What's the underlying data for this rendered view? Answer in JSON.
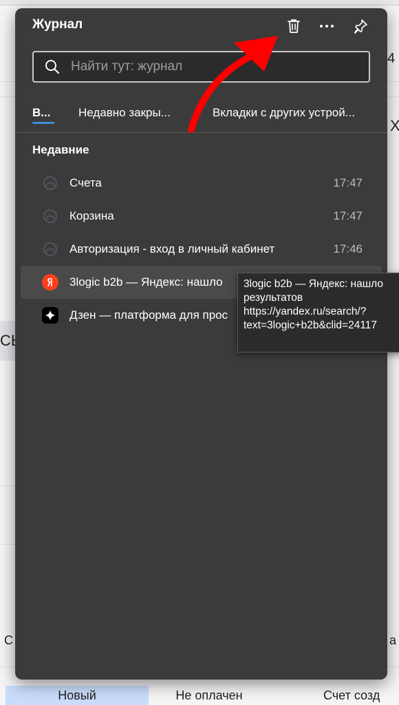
{
  "panel": {
    "title": "Журнал",
    "buttons": {
      "delete": "trash-icon",
      "more": "more-icon",
      "pin": "pin-icon"
    },
    "search_placeholder": "Найти тут: журнал"
  },
  "tabs": [
    {
      "label": "В...",
      "active": true
    },
    {
      "label": "Недавно закры...",
      "active": false
    },
    {
      "label": "Вкладки с других устрой...",
      "active": false
    }
  ],
  "section": "Недавние",
  "history": [
    {
      "title": "Счета",
      "time": "17:47",
      "icon": "site-icon"
    },
    {
      "title": "Корзина",
      "time": "17:47",
      "icon": "site-icon"
    },
    {
      "title": "Авторизация - вход в личный кабинет",
      "time": "17:46",
      "icon": "site-icon"
    },
    {
      "title": "3logic b2b — Яндекс: нашло",
      "time": "",
      "icon": "yandex-icon"
    },
    {
      "title": "Дзен — платформа для прос",
      "time": "",
      "icon": "dzen-icon"
    }
  ],
  "tooltip": {
    "line1": "3logic b2b — Яндекс: нашло",
    "line2": "результатов",
    "line3": "https://yandex.ru/search/?",
    "line4": "text=3logic+b2b&clid=24117"
  },
  "background": {
    "number": "4",
    "close_glyph": "Х",
    "fragment_left": "СЬ",
    "fragment_left2": "С",
    "fragment_right": "а",
    "cells": [
      "Новый",
      "Не оплачен",
      "Счет созд"
    ]
  },
  "colors": {
    "panel_bg": "#3b3b3b",
    "accent": "#3f8de0",
    "arrow": "#ff0000",
    "yandex": "#fc3f1d"
  }
}
